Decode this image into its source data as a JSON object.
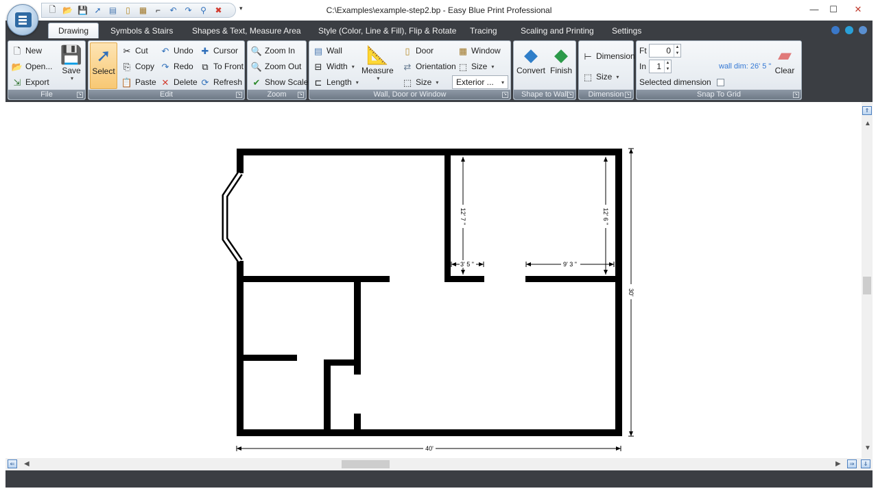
{
  "window": {
    "title": "C:\\Examples\\example-step2.bp - Easy Blue Print Professional",
    "minimize": "—",
    "maximize": "☐",
    "close": "✕"
  },
  "qat": {
    "icons": [
      "new-icon",
      "open-icon",
      "save-icon",
      "pointer-icon",
      "wall-icon",
      "door-icon",
      "window-icon",
      "dimension-icon",
      "undo-icon",
      "redo-icon",
      "measure-icon",
      "close-red-icon"
    ],
    "glyphs": [
      "🗋",
      "📂",
      "💾",
      "➚",
      "▤",
      "▯",
      "▦",
      "⌐",
      "↶",
      "↷",
      "⚲",
      "✖"
    ],
    "more": "▾"
  },
  "tabs": [
    {
      "label": "Drawing",
      "active": true
    },
    {
      "label": "Symbols & Stairs"
    },
    {
      "label": "Shapes & Text, Measure Area"
    },
    {
      "label": "Style (Color, Line & Fill), Flip & Rotate"
    },
    {
      "label": "Tracing"
    },
    {
      "label": "Scaling and Printing"
    },
    {
      "label": "Settings"
    }
  ],
  "groups": {
    "file": {
      "label": "File",
      "new": "New",
      "open": "Open...",
      "export": "Export",
      "save": "Save"
    },
    "edit": {
      "label": "Edit",
      "select": "Select",
      "cut": "Cut",
      "copy": "Copy",
      "paste": "Paste",
      "undo": "Undo",
      "redo": "Redo",
      "delete": "Delete",
      "cursor": "Cursor",
      "to_front": "To Front",
      "refresh": "Refresh"
    },
    "zoom": {
      "label": "Zoom",
      "zoom_in": "Zoom In",
      "zoom_out": "Zoom Out",
      "show_scale": "Show Scale"
    },
    "wall": {
      "label": "Wall, Door or Window",
      "wall": "Wall",
      "width": "Width",
      "length": "Length",
      "measure": "Measure",
      "door": "Door",
      "orientation": "Orientation",
      "size": "Size",
      "window": "Window",
      "size2": "Size",
      "wall_type": "Exterior ..."
    },
    "shape": {
      "label": "Shape to Wall",
      "convert": "Convert",
      "finish": "Finish"
    },
    "dimension": {
      "label": "Dimension",
      "dimension": "Dimension",
      "size": "Size"
    },
    "snap": {
      "label": "Snap To Grid",
      "ft_label": "Ft",
      "ft_value": "0",
      "in_label": "In",
      "in_value": "1",
      "selected_dimension": "Selected dimension",
      "wall_dim": "wall dim: 26' 5 \"",
      "clear": "Clear"
    }
  },
  "plan": {
    "dim_right_top": "12' 7 \"",
    "dim_far_right": "12' 6 \"",
    "dim_small": "3' 5 \"",
    "dim_opening": "9' 3 \"",
    "dim_height": "30'",
    "dim_width": "40'"
  },
  "colors": {
    "ribbon_dark": "#3b3e43",
    "accent_blue": "#3478d4",
    "select_orange": "#f8c874"
  }
}
